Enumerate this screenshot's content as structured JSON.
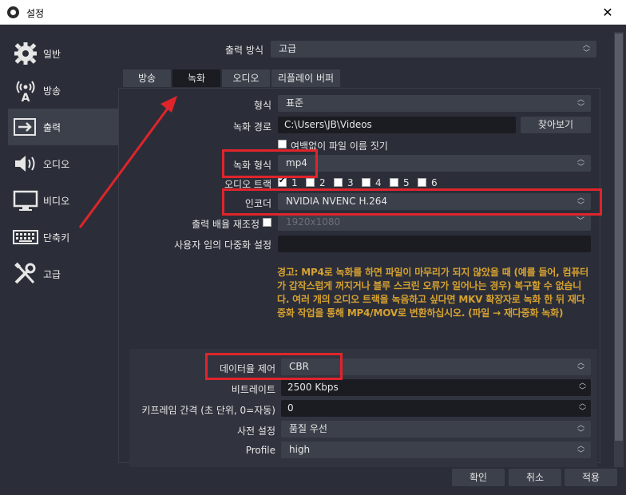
{
  "window": {
    "title": "설정",
    "close": "✕"
  },
  "sidebar": {
    "items": [
      {
        "label": "일반",
        "icon": "gear-icon"
      },
      {
        "label": "방송",
        "icon": "broadcast-icon"
      },
      {
        "label": "출력",
        "icon": "output-icon"
      },
      {
        "label": "오디오",
        "icon": "speaker-icon"
      },
      {
        "label": "비디오",
        "icon": "monitor-icon"
      },
      {
        "label": "단축키",
        "icon": "keyboard-icon"
      },
      {
        "label": "고급",
        "icon": "tools-icon"
      }
    ]
  },
  "output_mode": {
    "label": "출력 방식",
    "value": "고급"
  },
  "tabs": [
    "방송",
    "녹화",
    "오디오",
    "리플레이 버퍼"
  ],
  "recording": {
    "type_label": "형식",
    "type_value": "표준",
    "path_label": "녹화 경로",
    "path_value": "C:\\Users\\JB\\Videos",
    "browse_label": "찾아보기",
    "no_space_label": "여백없이 파일 이름 짓기",
    "format_label": "녹화 형식",
    "format_value": "mp4",
    "audio_track_label": "오디오 트랙",
    "tracks": [
      "1",
      "2",
      "3",
      "4",
      "5",
      "6"
    ],
    "encoder_label": "인코더",
    "encoder_value": "NVIDIA NVENC H.264",
    "rescale_label": "출력 배율 재조정",
    "rescale_value": "1920x1080",
    "muxer_label": "사용자 임의 다중화 설정",
    "muxer_value": "",
    "warning": "경고: MP4로 녹화를 하면 파일이 마무리가 되지 않았을 때 (예를 들어, 컴퓨터가 갑작스럽게 꺼지거나 블루 스크린 오류가 일어나는 경우) 복구할 수 없습니다. 여러 개의 오디오 트랙을 녹음하고 싶다면 MKV 확장자로 녹화 한 뒤 재다중화 작업을 통해 MP4/MOV로 변환하십시오. (파일 → 재다중화 녹화)"
  },
  "encoder_settings": {
    "rate_control_label": "데이터율 제어",
    "rate_control_value": "CBR",
    "bitrate_label": "비트레이트",
    "bitrate_value": "2500 Kbps",
    "keyframe_label": "키프레임 간격 (초 단위, 0=자동)",
    "keyframe_value": "0",
    "preset_label": "사전 설정",
    "preset_value": "품질 우선",
    "profile_label": "Profile",
    "profile_value": "high"
  },
  "buttons": {
    "ok": "확인",
    "cancel": "취소",
    "apply": "적용"
  },
  "annotation_color": "#e0242b"
}
